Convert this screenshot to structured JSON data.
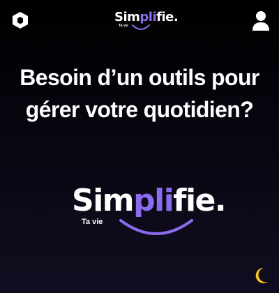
{
  "header": {
    "logo": {
      "part1": "Sim",
      "part2": "pli",
      "part3": "fie.",
      "tagline": "Ta vie"
    },
    "left_icon": "cube-icon",
    "right_icon": "user-icon"
  },
  "hero": {
    "line1": "Besoin d’un outils pour",
    "line2": "gérer votre quotidien?"
  },
  "center_logo": {
    "part1": "Sim",
    "part2": "pli",
    "part3": "fie.",
    "tagline": "Ta vie"
  },
  "theme_toggle": {
    "icon": "moon-icon"
  },
  "colors": {
    "accent": "#8b6cf0",
    "moon": "#f5c518",
    "text": "#ffffff",
    "background": "#000000"
  }
}
